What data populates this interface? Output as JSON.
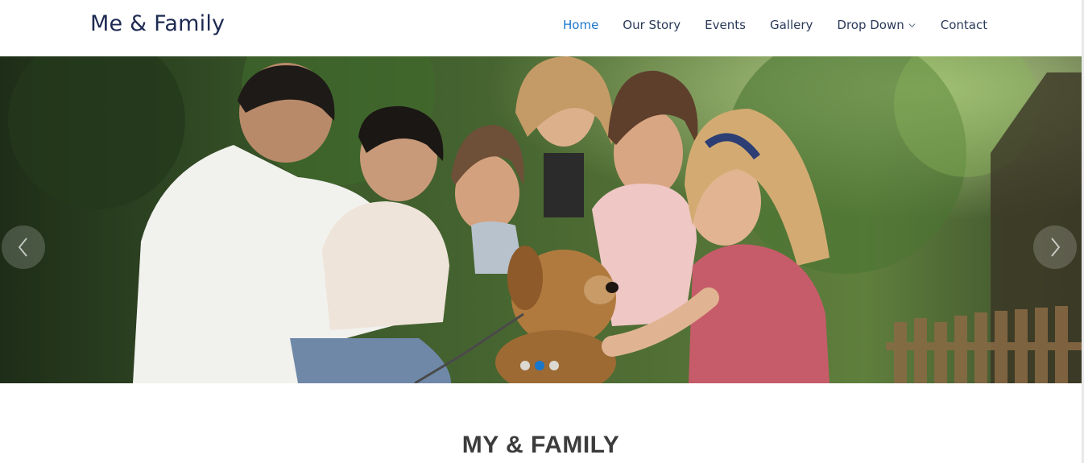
{
  "header": {
    "logo": "Me & Family",
    "nav": [
      {
        "label": "Home",
        "active": true
      },
      {
        "label": "Our Story",
        "active": false
      },
      {
        "label": "Events",
        "active": false
      },
      {
        "label": "Gallery",
        "active": false
      },
      {
        "label": "Drop Down",
        "active": false,
        "icon": "chevron-down-icon"
      },
      {
        "label": "Contact",
        "active": false
      }
    ]
  },
  "hero": {
    "image_subject": "family-with-dog-photo",
    "prev_icon": "chevron-left-icon",
    "next_icon": "chevron-right-icon",
    "slides_count": 3,
    "active_slide": 2
  },
  "section": {
    "title": "MY & FAMILY"
  },
  "colors": {
    "accent": "#1977cc",
    "logo": "#1e2a52",
    "nav_text": "#2b3a5a",
    "title_text": "#3c3c3c"
  }
}
